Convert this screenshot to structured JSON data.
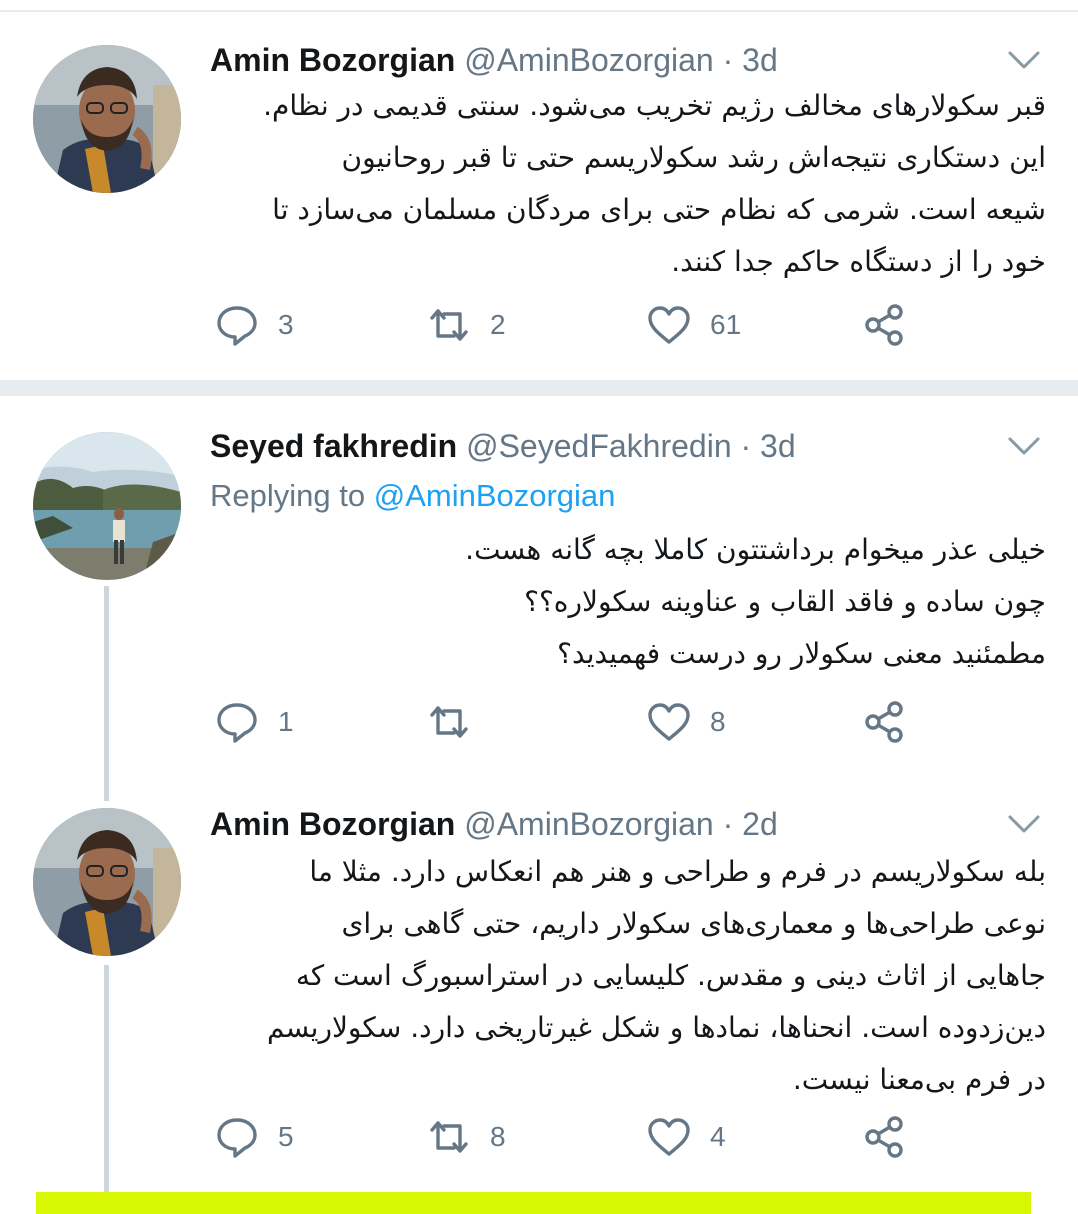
{
  "tweets": [
    {
      "name": "Amin Bozorgian",
      "handle": "@AminBozorgian",
      "separator": "·",
      "time": "3d",
      "lines": [
        "قبر سکولارهای مخالف رژیم تخریب می‌شود. سنتی قدیمی در نظام.",
        "این دستکاری نتیجه‌اش رشد سکولاریسم حتی تا قبر روحانیون",
        "شیعه است. شرمی که نظام حتی برای مردگان مسلمان می‌سازد تا",
        "خود را از دستگاه حاکم جدا کنند."
      ],
      "replies": "3",
      "retweets": "2",
      "likes": "61"
    },
    {
      "name": "Seyed fakhredin",
      "handle": "@SeyedFakhredin",
      "separator": "·",
      "time": "3d",
      "replying_label": "Replying to",
      "replying_handle": "@AminBozorgian",
      "lines": [
        "خیلی عذر میخوام برداشتتون کاملا بچه گانه هست.",
        "چون ساده و فاقد القاب و عناوینه سکولاره؟؟",
        "مطمئنید معنی سکولار رو درست فهمیدید؟"
      ],
      "replies": "1",
      "retweets": "",
      "likes": "8"
    },
    {
      "name": "Amin Bozorgian",
      "handle": "@AminBozorgian",
      "separator": "·",
      "time": "2d",
      "lines": [
        "بله سکولاریسم در فرم و طراحی و هنر هم انعکاس دارد. مثلا ما",
        "نوعی طراحی‌ها و معماری‌های سکولار داریم، حتی گاهی برای",
        "جاهایی از اثاث دینی و مقدس. کلیسایی در استراسبورگ است که",
        "دین‌زدوده است. انحناها، نمادها و شکل غیرتاریخی دارد. سکولاریسم",
        "در فرم بی‌معنا نیست."
      ],
      "replies": "5",
      "retweets": "8",
      "likes": "4"
    }
  ],
  "icons": {
    "reply": "reply-icon",
    "retweet": "retweet-icon",
    "like": "like-icon",
    "share": "share-icon",
    "menu": "chevron-down-icon"
  },
  "colors": {
    "text": "#14171a",
    "secondary": "#657786",
    "link": "#1da1f2",
    "divider": "#e6ecf0",
    "thread_line": "#ccd6dd",
    "highlight": "#d8f702"
  }
}
